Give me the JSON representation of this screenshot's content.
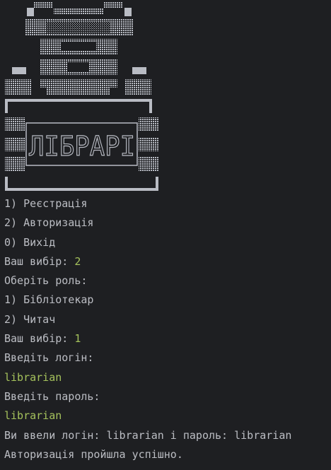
{
  "colors": {
    "background": "#1e1f22",
    "text": "#bcbec4",
    "user_input": "#a5c25c"
  },
  "console": {
    "banner": {
      "graphic": "block-character ascii art banner (robot with sign)",
      "sign_text": "ЛІБРАРІ"
    },
    "lines": [
      {
        "prompt": "1) Реєстрація",
        "input": ""
      },
      {
        "prompt": "2) Авторизація",
        "input": ""
      },
      {
        "prompt": "0) Вихід",
        "input": ""
      },
      {
        "prompt": "Ваш вибір: ",
        "input": "2"
      },
      {
        "prompt": "Оберіть роль:",
        "input": ""
      },
      {
        "prompt": "1) Бібліотекар",
        "input": ""
      },
      {
        "prompt": "2) Читач",
        "input": ""
      },
      {
        "prompt": "Ваш вибір: ",
        "input": "1"
      },
      {
        "prompt": "Введіть логін:",
        "input": ""
      },
      {
        "prompt": "",
        "input": "librarian"
      },
      {
        "prompt": "Введіть пароль:",
        "input": ""
      },
      {
        "prompt": "",
        "input": "librarian"
      },
      {
        "prompt": "Ви ввели логін: librarian і пароль: librarian",
        "input": ""
      },
      {
        "prompt": "Авторизація пройшла успішно.",
        "input": ""
      }
    ]
  }
}
